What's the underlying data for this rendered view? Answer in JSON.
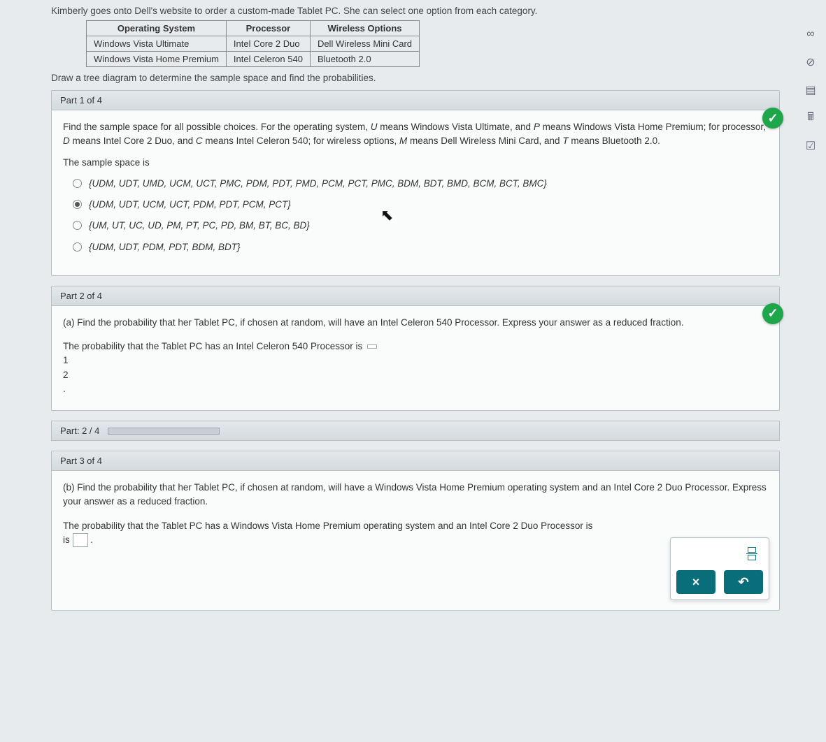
{
  "intro": "Kimberly goes onto Dell's website to order a custom-made Tablet PC. She can select one option from each category.",
  "table": {
    "headers": [
      "Operating System",
      "Processor",
      "Wireless Options"
    ],
    "rows": [
      [
        "Windows Vista Ultimate",
        "Intel Core 2 Duo",
        "Dell Wireless Mini Card"
      ],
      [
        "Windows Vista Home Premium",
        "Intel Celeron 540",
        "Bluetooth 2.0"
      ]
    ]
  },
  "instruction": "Draw a tree diagram to determine the sample space and find the probabilities.",
  "part1": {
    "header": "Part 1 of 4",
    "prompt_a": "Find the sample space for all possible choices. For the operating system, ",
    "k_U": "U",
    "t_U": " means Windows Vista Ultimate, and ",
    "k_P": "P",
    "t_P": " means Windows Vista Home Premium; for processor, ",
    "k_D": "D",
    "t_D": " means Intel Core 2 Duo, and ",
    "k_C": "C",
    "t_C": " means Intel Celeron 540; for wireless options, ",
    "k_M": "M",
    "t_M": " means Dell Wireless Mini Card, and ",
    "k_T": "T",
    "t_T": " means Bluetooth 2.0.",
    "lead": "The sample space is",
    "opts": [
      "{UDM, UDT, UMD, UCM, UCT, PMC, PDM, PDT, PMD, PCM, PCT, PMC, BDM, BDT, BMD, BCM, BCT, BMC}",
      "{UDM, UDT, UCM, UCT, PDM, PDT, PCM, PCT}",
      "{UM, UT, UC, UD, PM, PT, PC, PD, BM, BT, BC, BD}",
      "{UDM, UDT, PDM, PDT, BDM, BDT}"
    ],
    "selected": 1
  },
  "part2": {
    "header": "Part 2 of 4",
    "q": "(a) Find the probability that her Tablet PC, if chosen at random, will have an Intel Celeron 540 Processor. Express your answer as a reduced fraction.",
    "ans_lead": "The probability that the Tablet PC has an Intel Celeron 540 Processor is ",
    "num": "1",
    "den": "2",
    "trail": "."
  },
  "progress": {
    "label": "Part: 2 / 4",
    "pct": 50
  },
  "part3": {
    "header": "Part 3 of 4",
    "q": "(b) Find the probability that her Tablet PC, if chosen at random, will have a Windows Vista Home Premium operating system and an Intel Core 2 Duo Processor. Express your answer as a reduced fraction.",
    "ans_lead": "The probability that the Tablet PC has a Windows Vista Home Premium operating system and an Intel Core 2 Duo Processor is ",
    "trail": "."
  },
  "buttons": {
    "clear": "×",
    "undo": "↶"
  },
  "side": {
    "link": "link-icon",
    "help": "help-icon",
    "doc": "doc-icon",
    "calc": "calc-icon",
    "flag": "flag-icon"
  }
}
